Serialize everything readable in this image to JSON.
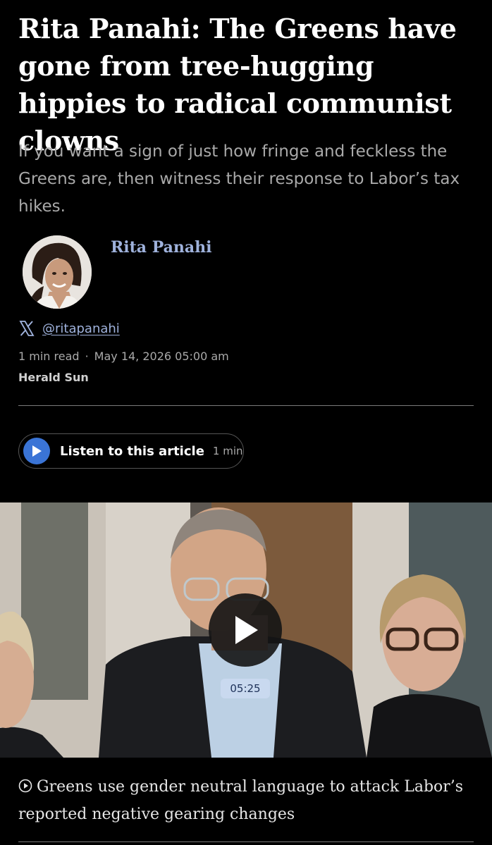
{
  "article": {
    "headline": "Rita Panahi: The Greens have gone from tree-hugging hippies to radical communist clowns",
    "standfirst": "If you want a sign of just how fringe and feckless the Greens are, then witness their response to Labor’s tax hikes."
  },
  "author": {
    "name": "Rita Panahi",
    "handle": "@ritapanahi",
    "social_icon": "x-logo-icon"
  },
  "meta": {
    "read_time": "1 min read",
    "separator": "·",
    "date": "May 14, 2026 05:00 am",
    "masthead": "Herald Sun"
  },
  "listen": {
    "label": "Listen to this article",
    "duration": "1 min",
    "accent": "#3a74d6"
  },
  "video": {
    "duration": "05:25",
    "caption": "Greens use gender neutral language to attack Labor’s reported negative gearing changes"
  },
  "colors": {
    "background": "#000000",
    "link": "#9fb2dc",
    "muted": "#a9a9a9"
  }
}
